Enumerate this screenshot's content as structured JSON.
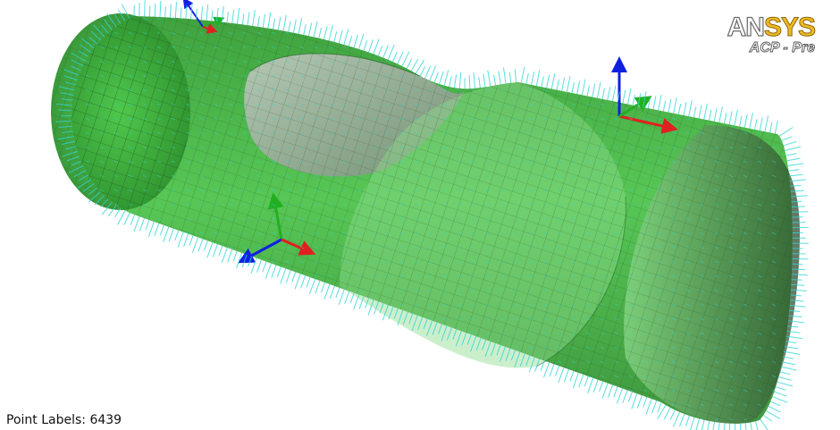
{
  "logo": {
    "brand_a": "AN",
    "brand_b": "SYS",
    "subtitle": "ACP - Pre"
  },
  "status": {
    "text": "Point Labels: 6439"
  },
  "scene": {
    "model": "cylindrical-tube-mesh",
    "colors": {
      "surface": "#3dba3a",
      "surface_dark": "#1f7d22",
      "inner": "#b0b4b0",
      "mesh": "#1d4d1d",
      "normals": "#2fd6d6",
      "axis_x": "#e02020",
      "axis_y": "#22b022",
      "axis_z": "#1020e0"
    }
  }
}
